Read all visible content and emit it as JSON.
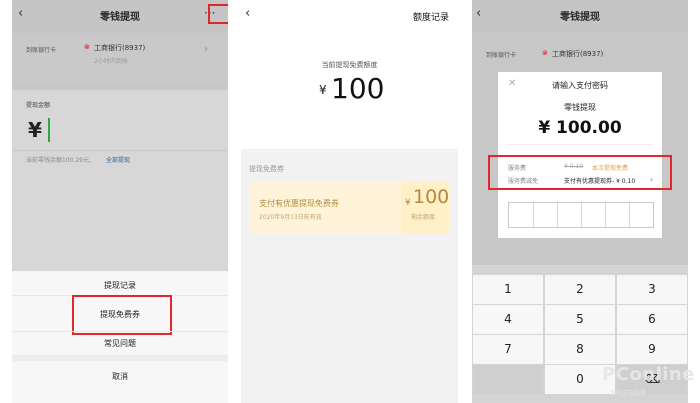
{
  "screens": {
    "withdraw_sheet": {
      "nav_title": "零钱提现",
      "back_icon": "chevron-left-icon",
      "more_icon": "more-dots-icon",
      "bank_label": "到账银行卡",
      "bank_name": "工商银行(8937)",
      "arrival_time": "2小时内到账",
      "amount_label": "提现金额",
      "currency_symbol": "¥",
      "balance_text": "当前零钱余额100.29元,",
      "withdraw_all": "全部提现",
      "action_sheet": {
        "items": [
          "提现记录",
          "提现免费券",
          "常见问题"
        ],
        "cancel": "取消"
      }
    },
    "quota_record": {
      "nav_title": "额度记录",
      "back_icon": "chevron-left-icon",
      "quota_label": "当前提现免费额度",
      "currency_symbol": "¥",
      "quota_amount": "100",
      "coupon_section_label": "提现免费券",
      "coupon": {
        "title": "支付有优惠提现免费券",
        "date": "2020年9月13日前有效",
        "currency_symbol": "¥",
        "amount": "100",
        "remaining_label": "剩余额度"
      }
    },
    "payment_password": {
      "nav_title": "零钱提现",
      "back_icon": "chevron-left-icon",
      "bank_label": "到账银行卡",
      "bank_name": "工商银行(8937)",
      "dialog": {
        "close_icon": "close-icon",
        "title": "请输入支付密码",
        "subtitle": "零钱提现",
        "amount": "¥ 100.00",
        "fee_label": "服务费",
        "fee_original": "¥ 0.10",
        "fee_note": "本次提现免费",
        "discount_label": "服务费减免",
        "discount_value": "支付有优惠提现券- ¥ 0.10",
        "discount_chevron": "chevron-right-icon"
      },
      "keypad": {
        "rows": [
          [
            "1",
            "2",
            "3"
          ],
          [
            "4",
            "5",
            "6"
          ],
          [
            "7",
            "8",
            "9"
          ],
          [
            "",
            "0",
            ""
          ]
        ],
        "backspace_icon": "backspace-icon"
      }
    }
  },
  "watermark": {
    "brand": "PConline",
    "sub": "太平洋电脑网"
  },
  "colors": {
    "highlight": "#e3262b",
    "green_cursor": "#2aa747",
    "gold": "#b38a3b",
    "link_blue": "#2f5f9e"
  }
}
